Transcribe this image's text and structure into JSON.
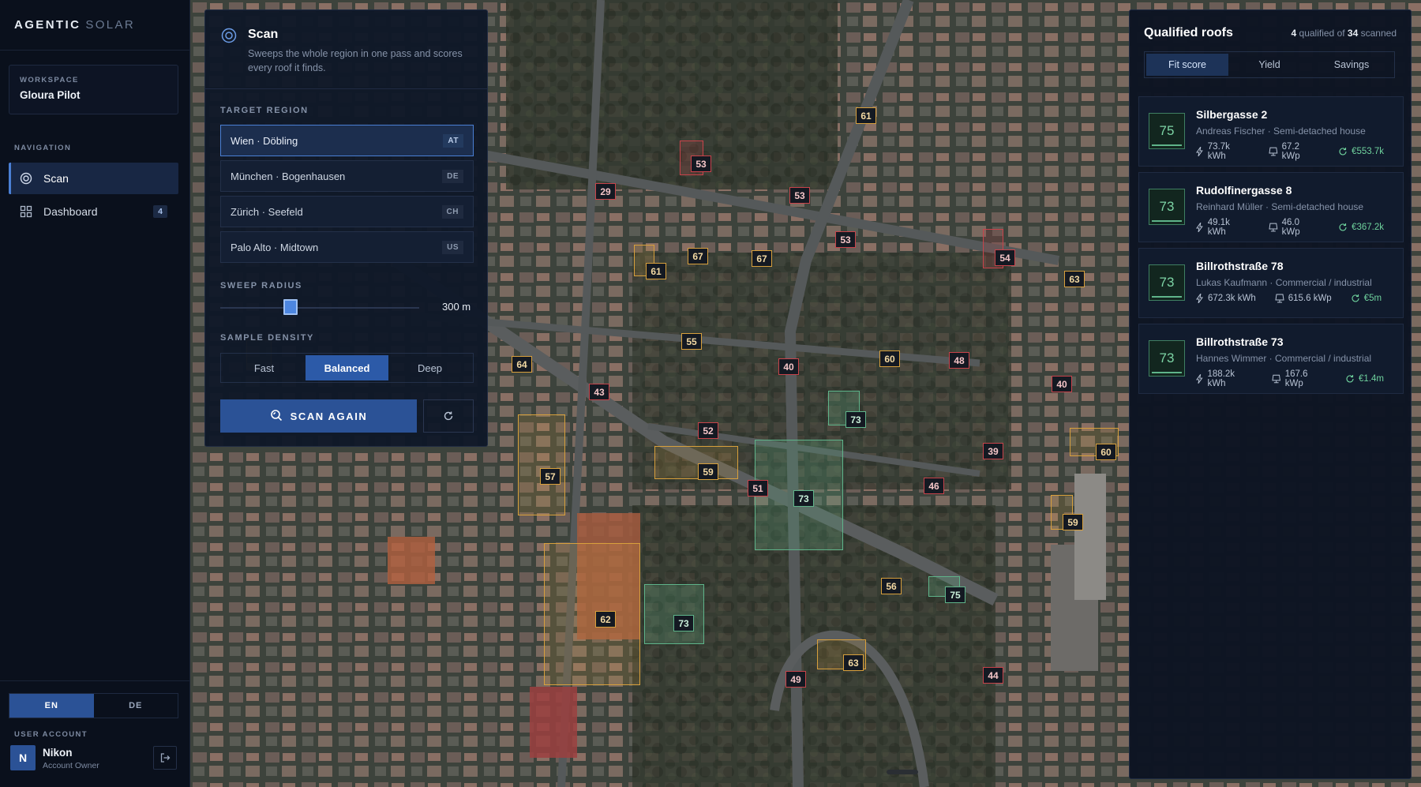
{
  "brand": {
    "primary": "AGENTIC",
    "secondary": "SOLAR"
  },
  "workspace": {
    "label": "WORKSPACE",
    "name": "Gloura Pilot"
  },
  "nav": {
    "label": "NAVIGATION",
    "items": [
      {
        "label": "Scan",
        "icon": "scan-icon",
        "active": true
      },
      {
        "label": "Dashboard",
        "icon": "grid-icon",
        "badge": "4"
      }
    ]
  },
  "language": {
    "options": [
      "EN",
      "DE"
    ],
    "selected": "EN"
  },
  "user": {
    "section_label": "USER ACCOUNT",
    "initial": "N",
    "name": "Nikon",
    "role": "Account Owner"
  },
  "scan": {
    "title": "Scan",
    "description": "Sweeps the whole region in one pass and scores every roof it finds.",
    "target_region_label": "TARGET REGION",
    "regions": [
      {
        "name": "Wien · Döbling",
        "code": "AT",
        "selected": true
      },
      {
        "name": "München · Bogenhausen",
        "code": "DE"
      },
      {
        "name": "Zürich · Seefeld",
        "code": "CH"
      },
      {
        "name": "Palo Alto · Midtown",
        "code": "US"
      }
    ],
    "sweep_radius_label": "SWEEP RADIUS",
    "sweep_radius_value": "300 m",
    "sweep_radius_fraction": 0.35,
    "density_label": "SAMPLE DENSITY",
    "density_options": [
      "Fast",
      "Balanced",
      "Deep"
    ],
    "density_selected": "Balanced",
    "scan_button": "SCAN AGAIN"
  },
  "results": {
    "title": "Qualified roofs",
    "qualified": "4",
    "qualified_text": "qualified of",
    "scanned": "34",
    "scanned_text": "scanned",
    "tabs": [
      "Fit score",
      "Yield",
      "Savings"
    ],
    "active_tab": "Fit score",
    "roofs": [
      {
        "score": "75",
        "address": "Silbergasse 2",
        "owner": "Andreas Fischer · Semi-detached house",
        "yield": "73.7k kWh",
        "power": "67.2 kWp",
        "savings": "€553.7k"
      },
      {
        "score": "73",
        "address": "Rudolfinergasse 8",
        "owner": "Reinhard Müller · Semi-detached house",
        "yield": "49.1k kWh",
        "power": "46.0 kWp",
        "savings": "€367.2k"
      },
      {
        "score": "73",
        "address": "Billrothstraße 78",
        "owner": "Lukas Kaufmann · Commercial / industrial",
        "yield": "672.3k kWh",
        "power": "615.6 kWp",
        "savings": "€5m"
      },
      {
        "score": "73",
        "address": "Billrothstraße 73",
        "owner": "Hannes Wimmer · Commercial / industrial",
        "yield": "188.2k kWh",
        "power": "167.6 kWp",
        "savings": "€1.4m"
      }
    ]
  },
  "map_markers": [
    {
      "score": "61",
      "status": "orange"
    },
    {
      "score": "53",
      "status": "red"
    },
    {
      "score": "29",
      "status": "red"
    },
    {
      "score": "53",
      "status": "red"
    },
    {
      "score": "53",
      "status": "red"
    },
    {
      "score": "61",
      "status": "orange"
    },
    {
      "score": "67",
      "status": "orange"
    },
    {
      "score": "67",
      "status": "orange"
    },
    {
      "score": "54",
      "status": "red"
    },
    {
      "score": "63",
      "status": "orange"
    },
    {
      "score": "55",
      "status": "orange"
    },
    {
      "score": "64",
      "status": "orange"
    },
    {
      "score": "40",
      "status": "red"
    },
    {
      "score": "60",
      "status": "orange"
    },
    {
      "score": "48",
      "status": "red"
    },
    {
      "score": "43",
      "status": "red"
    },
    {
      "score": "40",
      "status": "red"
    },
    {
      "score": "73",
      "status": "green"
    },
    {
      "score": "52",
      "status": "red"
    },
    {
      "score": "39",
      "status": "red"
    },
    {
      "score": "60",
      "status": "orange"
    },
    {
      "score": "57",
      "status": "orange"
    },
    {
      "score": "59",
      "status": "orange"
    },
    {
      "score": "51",
      "status": "red"
    },
    {
      "score": "73",
      "status": "green"
    },
    {
      "score": "46",
      "status": "red"
    },
    {
      "score": "59",
      "status": "orange"
    },
    {
      "score": "62",
      "status": "orange"
    },
    {
      "score": "73",
      "status": "green"
    },
    {
      "score": "56",
      "status": "orange"
    },
    {
      "score": "75",
      "status": "green"
    },
    {
      "score": "49",
      "status": "red"
    },
    {
      "score": "63",
      "status": "orange"
    },
    {
      "score": "44",
      "status": "red"
    }
  ],
  "colors": {
    "accent": "#2b5296",
    "good": "#5fb48a",
    "warn": "#d8a03c",
    "bad": "#c8434a"
  }
}
